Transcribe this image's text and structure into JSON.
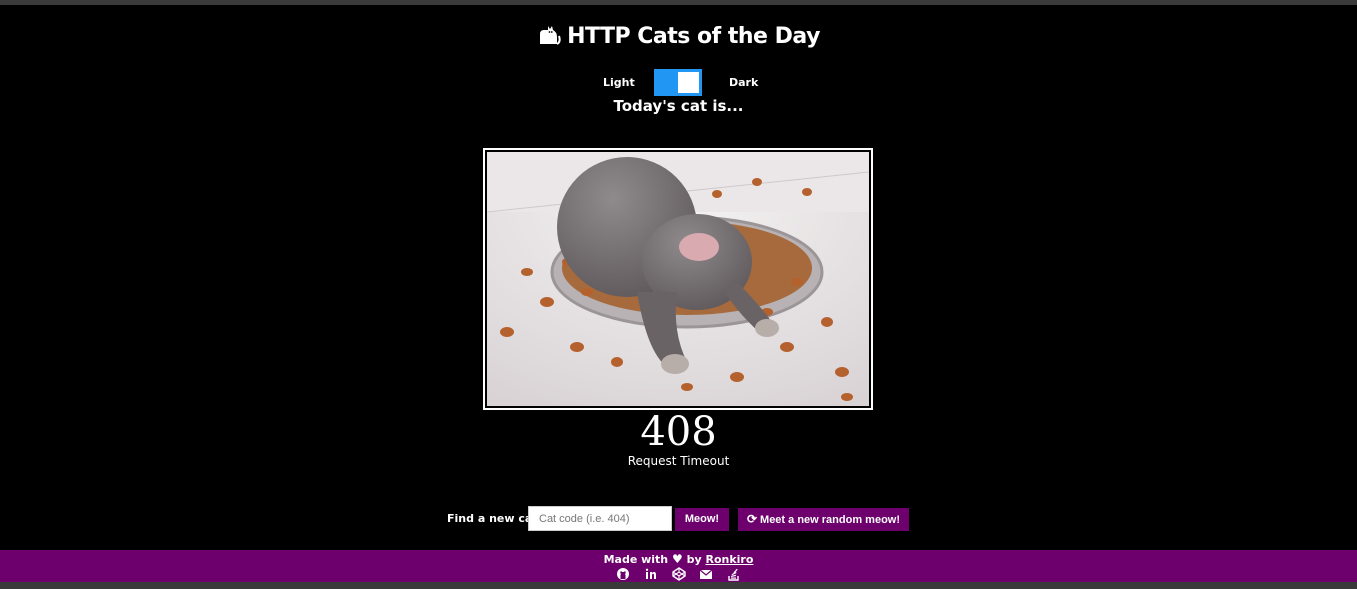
{
  "header": {
    "title": "HTTP Cats of the Day",
    "theme_light_label": "Light",
    "theme_dark_label": "Dark",
    "theme_mode": "dark",
    "subtitle": "Today's cat is..."
  },
  "cat": {
    "image_icon": "kitten-asleep-in-food-bowl-photo",
    "status_code": "408",
    "status_text": "Request Timeout"
  },
  "search": {
    "label": "Find a new cat:",
    "input_value": "",
    "placeholder": "Cat code (i.e. 404)",
    "meow_button": "Meow!",
    "random_button": "Meet a new random meow!"
  },
  "footer": {
    "made_with": "Made with",
    "by": "by",
    "author": "Ronkiro",
    "social_icons": [
      "github-icon",
      "linkedin-icon",
      "codepen-icon",
      "email-icon",
      "stackoverflow-icon"
    ]
  },
  "colors": {
    "background": "#000000",
    "accent_purple": "#6d006d",
    "toggle_blue": "#2196f3"
  }
}
